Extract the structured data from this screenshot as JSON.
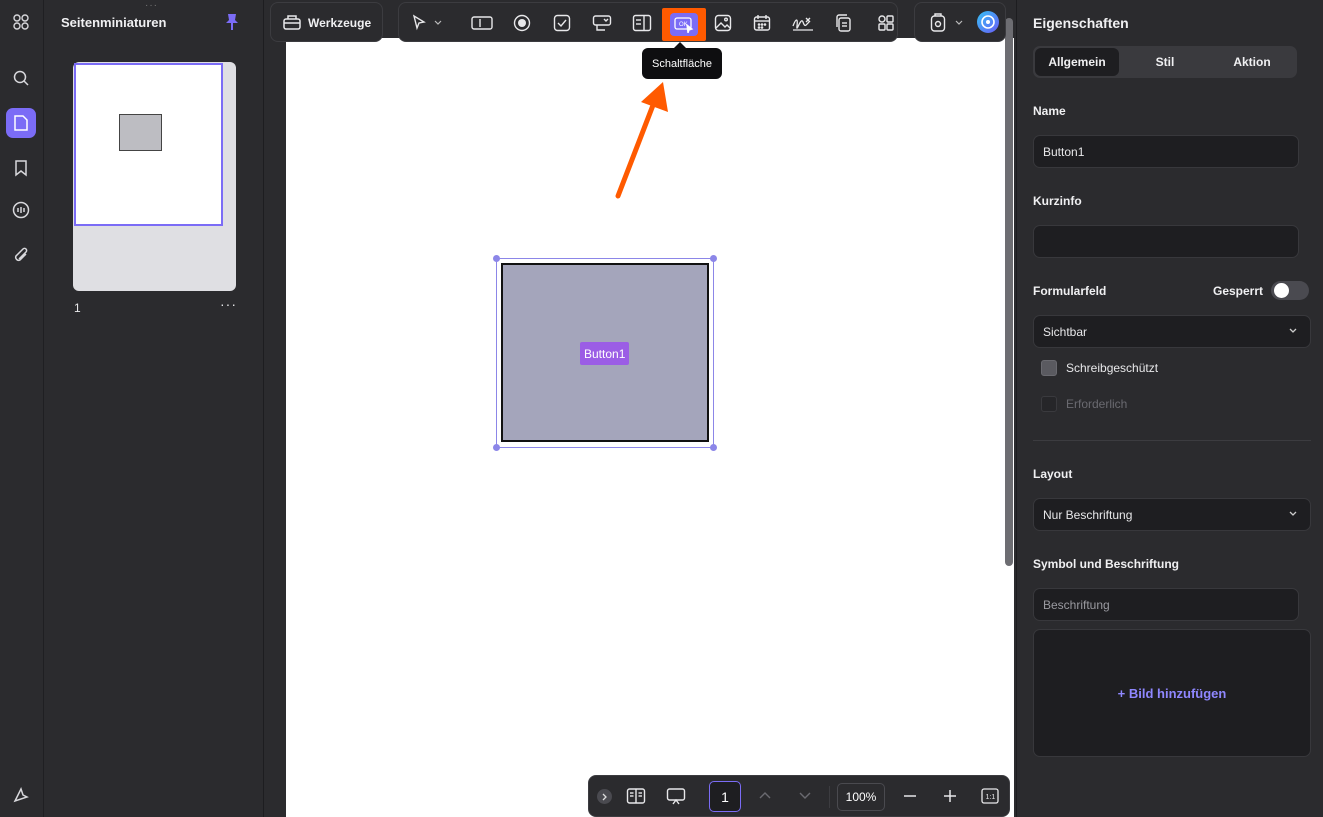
{
  "sidebar": {
    "title": "Seitenminiaturen",
    "page_number": "1",
    "more": "···",
    "rail_icons": [
      "apps-grid-icon",
      "search-icon",
      "page-thumbnails-icon",
      "bookmark-icon",
      "comment-icon",
      "attachment-icon",
      "ai-assistant-icon"
    ]
  },
  "toolbar": {
    "werkzeuge_label": "Werkzeuge",
    "tooltip": "Schaltfläche",
    "tools": [
      "select-icon",
      "text-field-icon",
      "radio-button-icon",
      "checkbox-icon",
      "combo-box-icon",
      "list-box-icon",
      "push-button-icon",
      "image-field-icon",
      "date-field-icon",
      "signature-field-icon",
      "duplicate-icon",
      "more-fields-icon"
    ]
  },
  "canvas": {
    "button_label": "Button1"
  },
  "bottom_bar": {
    "page_value": "1",
    "zoom": "100%"
  },
  "properties": {
    "header": "Eigenschaften",
    "tabs": [
      "Allgemein",
      "Stil",
      "Aktion"
    ],
    "active_tab": "Allgemein",
    "name_label": "Name",
    "name_value": "Button1",
    "tooltip_label": "Kurzinfo",
    "tooltip_value": "",
    "form_field_label": "Formularfeld",
    "locked_label": "Gesperrt",
    "visibility_value": "Sichtbar",
    "readonly_label": "Schreibgeschützt",
    "required_label": "Erforderlich",
    "layout_label": "Layout",
    "layout_value": "Nur Beschriftung",
    "icon_caption_label": "Symbol und Beschriftung",
    "caption_placeholder": "Beschriftung",
    "add_image": "+ Bild hinzufügen"
  },
  "colors": {
    "accent": "#7b6cf6",
    "highlight": "#ff5a00",
    "button_fill": "#a4a5bb",
    "button_label_bg": "#9b5de5"
  }
}
